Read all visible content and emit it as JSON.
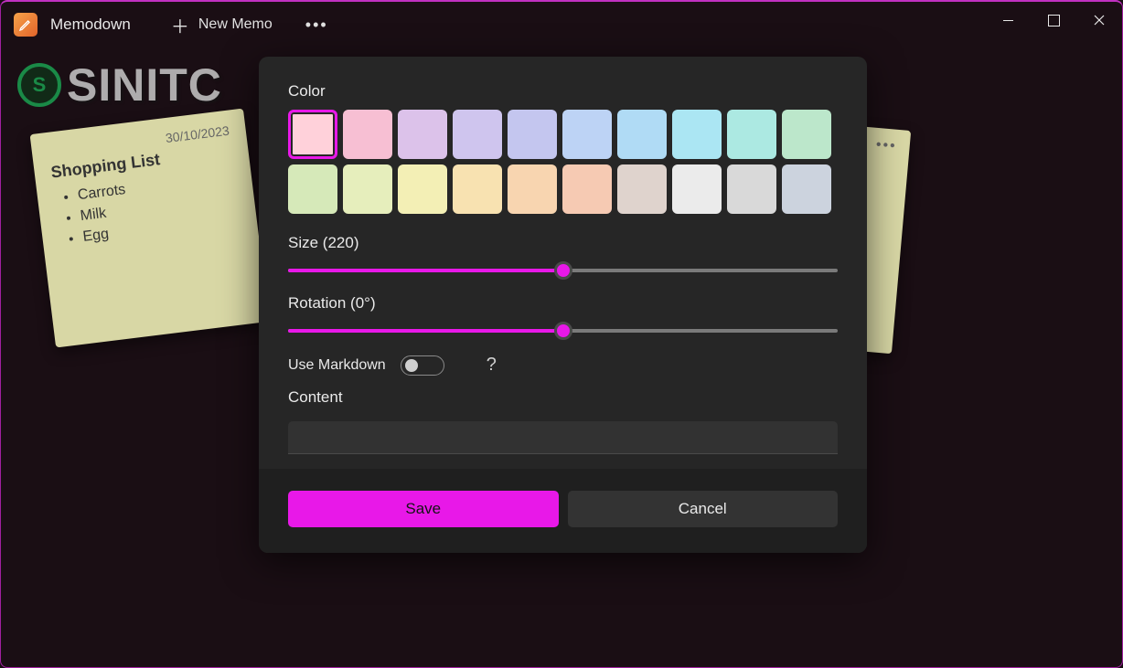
{
  "app": {
    "title": "Memodown",
    "new_memo_label": "New Memo"
  },
  "watermark": {
    "text": "SINITC",
    "badge_letter": "S"
  },
  "sticky_note": {
    "date": "30/10/2023",
    "title": "Shopping List",
    "items": [
      "Carrots",
      "Milk",
      "Egg"
    ]
  },
  "dialog": {
    "color_label": "Color",
    "colors": [
      "#ffd1da",
      "#f7bfd3",
      "#dcc2ea",
      "#cfc5ee",
      "#c4c6ef",
      "#bdd3f5",
      "#b0dbf5",
      "#abe6f3",
      "#ace9e2",
      "#bce7cb",
      "#d6e9b9",
      "#e6eebc",
      "#f3efb5",
      "#f8e2b1",
      "#f8d5b0",
      "#f6cab3",
      "#dfd3cd",
      "#ebebeb",
      "#d9d9d9",
      "#ccd3de"
    ],
    "selected_color_index": 0,
    "size_label": "Size (220)",
    "size_value": 220,
    "size_percent": 50,
    "rotation_label": "Rotation (0°)",
    "rotation_value": 0,
    "rotation_percent": 50,
    "markdown_label": "Use Markdown",
    "markdown_on": false,
    "help_symbol": "?",
    "content_label": "Content",
    "content_value": "",
    "save_label": "Save",
    "cancel_label": "Cancel"
  }
}
